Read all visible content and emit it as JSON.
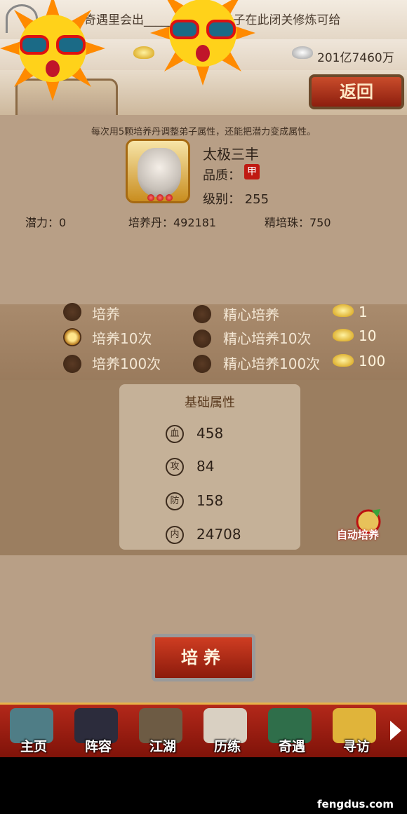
{
  "marquee": {
    "text": "奇遇里会出___________上弟子在此闭关修炼可给"
  },
  "currency": {
    "silver": "201亿7460万"
  },
  "header": {
    "back_label": "返回"
  },
  "hint": "每次用5颗培养丹调整弟子属性，还能把潜力变成属性。",
  "hero": {
    "name": "太极三丰",
    "quality_label": "品质：",
    "quality_badge": "甲",
    "level_label": "级别：",
    "level_value": "255"
  },
  "stats": {
    "potential": "潜力：0",
    "pills": "培养丹：492181",
    "beads": "精培珠：750"
  },
  "training_options": {
    "basic": [
      {
        "label": "培养",
        "selected": false
      },
      {
        "label": "培养10次",
        "selected": true
      },
      {
        "label": "培养100次",
        "selected": false
      }
    ],
    "advanced": [
      {
        "label": "精心培养",
        "cost": "1",
        "selected": false
      },
      {
        "label": "精心培养10次",
        "cost": "10",
        "selected": false
      },
      {
        "label": "精心培养100次",
        "cost": "100",
        "selected": false
      }
    ]
  },
  "attributes": {
    "title": "基础属性",
    "rows": [
      {
        "icon": "血",
        "value": "458"
      },
      {
        "icon": "攻",
        "value": "84"
      },
      {
        "icon": "防",
        "value": "158"
      },
      {
        "icon": "内",
        "value": "24708"
      }
    ]
  },
  "auto_train_label": "自动培养",
  "train_button_label": "培养",
  "nav": [
    {
      "label": "主页",
      "color": "#4f7d86"
    },
    {
      "label": "阵容",
      "color": "#2c2c3c"
    },
    {
      "label": "江湖",
      "color": "#6d5b44"
    },
    {
      "label": "历练",
      "color": "#d9d0c2"
    },
    {
      "label": "奇遇",
      "color": "#2f6e4a"
    },
    {
      "label": "寻访",
      "color": "#e0b43a"
    }
  ],
  "watermark": "fengdus.com"
}
